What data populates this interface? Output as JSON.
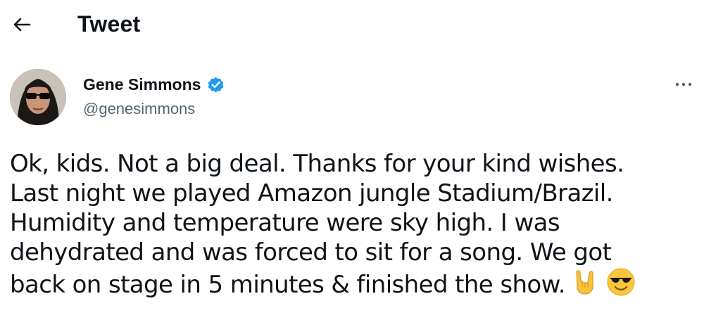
{
  "header": {
    "title": "Tweet",
    "back_icon": "arrow-left-icon"
  },
  "tweet": {
    "author": {
      "display_name": "Gene Simmons",
      "handle": "@genesimmons",
      "verified": true,
      "verified_color": "#1d9bf0"
    },
    "more_icon": "more-horizontal-icon",
    "text_lines": [
      "Ok, kids. Not a big deal. Thanks for your kind wishes.",
      "Last night we played Amazon jungle Stadium/Brazil.",
      "Humidity and temperature were sky high. I was",
      "dehydrated and was forced to sit for a song. We got",
      "back on stage in 5 minutes & finished the show."
    ],
    "emojis": [
      "sign-of-the-horns-emoji",
      "smiling-face-with-sunglasses-emoji"
    ]
  },
  "colors": {
    "text_primary": "#0f1419",
    "text_secondary": "#536471",
    "accent": "#1d9bf0"
  }
}
